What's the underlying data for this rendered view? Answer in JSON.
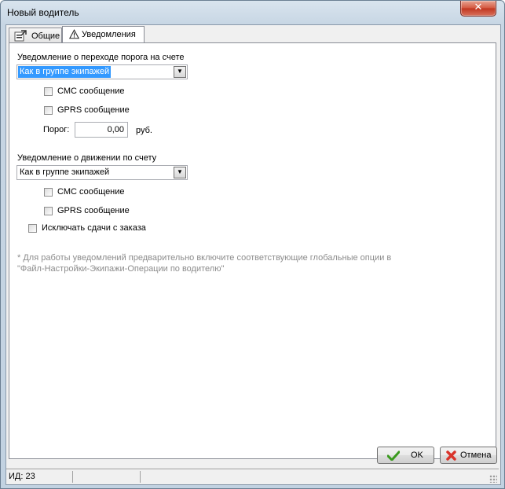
{
  "window": {
    "title": "Новый водитель",
    "close_glyph": "✕"
  },
  "tabs": [
    {
      "label": "Общие",
      "icon": "properties-icon"
    },
    {
      "label": "Уведомления",
      "icon": "warning-icon"
    }
  ],
  "threshold": {
    "heading": "Уведомление о переходе порога на счете",
    "combo_value": "Как в группе экипажей",
    "sms_label": "СМС сообщение",
    "gprs_label": "GPRS сообщение",
    "threshold_label": "Порог:",
    "threshold_value": "0,00",
    "currency": "руб."
  },
  "movement": {
    "heading": "Уведомление о движении по счету",
    "combo_value": "Как в группе экипажей",
    "sms_label": "СМС сообщение",
    "gprs_label": "GPRS сообщение"
  },
  "exclude_label": "Исключать сдачи с заказа",
  "note_line1": "* Для работы уведомлений предварительно включите соответствующие глобальные опции в",
  "note_line2": "\"Файл-Настройки-Экипажи-Операции по водителю\"",
  "buttons": {
    "ok": "OK",
    "cancel": "Отмена"
  },
  "status": {
    "id_text": "ИД: 23"
  },
  "colors": {
    "selection": "#3399ff",
    "ok_check": "#3a9a1e",
    "cancel_x": "#d9342b"
  }
}
